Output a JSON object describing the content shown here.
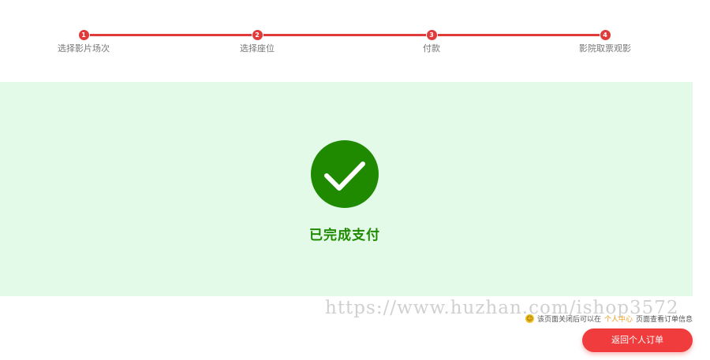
{
  "steps": [
    {
      "number": "1",
      "label": "选择影片场次"
    },
    {
      "number": "2",
      "label": "选择座位"
    },
    {
      "number": "3",
      "label": "付款"
    },
    {
      "number": "4",
      "label": "影院取票观影"
    }
  ],
  "success": {
    "message": "已完成支付"
  },
  "notice": {
    "icon": "smile-icon",
    "text_before": "该页面关闭后可以在",
    "text_accent": "个人中心",
    "text_after": "页面查看订单信息"
  },
  "watermark": "https://www.huzhan.com/ishop3572",
  "actions": {
    "return_label": "返回个人订单"
  },
  "colors": {
    "accent_red": "#e03a3a",
    "success_green": "#1f8a00",
    "panel_bg": "#e3fae9"
  }
}
